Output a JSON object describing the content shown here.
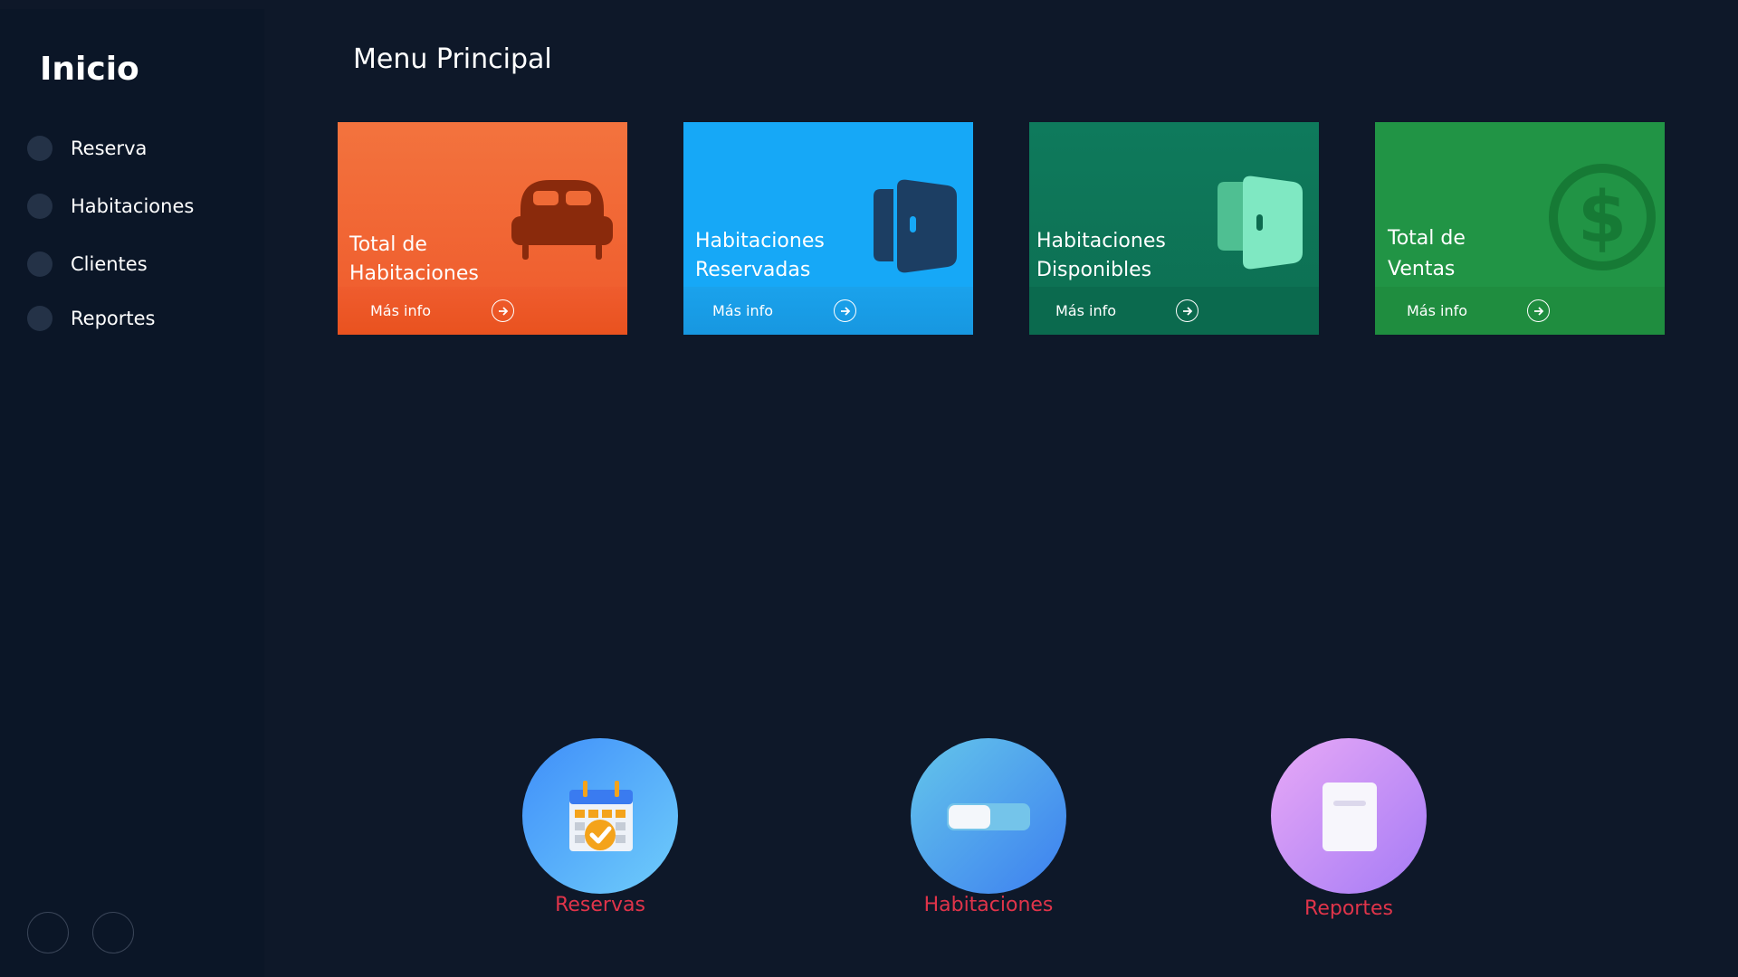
{
  "sidebar": {
    "title": "Inicio",
    "items": [
      {
        "label": "Reserva"
      },
      {
        "label": "Habitaciones"
      },
      {
        "label": "Clientes"
      },
      {
        "label": "Reportes"
      }
    ]
  },
  "main": {
    "title": "Menu Principal",
    "cards": [
      {
        "title_line1": "Total de",
        "title_line2": "Habitaciones",
        "more": "Más info",
        "icon": "bed-icon",
        "color": "#f2653a"
      },
      {
        "title_line1": "Habitaciones",
        "title_line2": "Reservadas",
        "more": "Más info",
        "icon": "door-icon",
        "color": "#16a5f5"
      },
      {
        "title_line1": "Habitaciones",
        "title_line2": "Disponibles",
        "more": "Más info",
        "icon": "door-open-icon",
        "color": "#10785a"
      },
      {
        "title_line1": "Total de",
        "title_line2": "Ventas",
        "more": "Más info",
        "icon": "dollar-icon",
        "color": "#219445"
      }
    ],
    "shortcuts": [
      {
        "label": "Reservas",
        "icon": "calendar-icon"
      },
      {
        "label": "Habitaciones",
        "icon": "toggle-icon"
      },
      {
        "label": "Reportes",
        "icon": "document-icon"
      }
    ]
  }
}
